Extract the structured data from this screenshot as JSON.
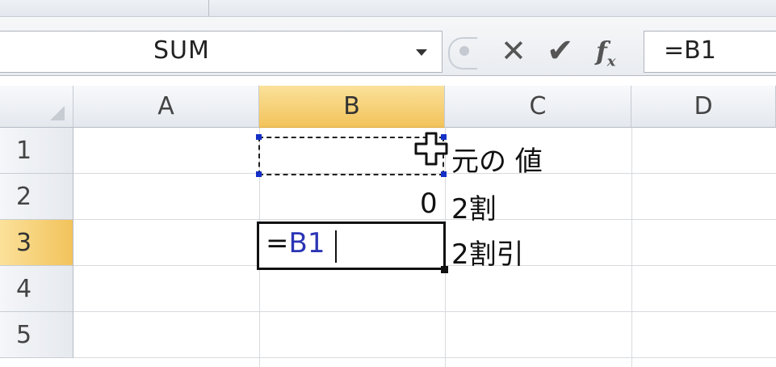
{
  "name_box": {
    "value": "SUM"
  },
  "formula_bar": {
    "cancel_icon": "cross-icon",
    "enter_icon": "check-icon",
    "fx_label": "f",
    "fx_sub": "x",
    "formula": "=B1"
  },
  "columns": [
    "A",
    "B",
    "C",
    "D"
  ],
  "selected_column": "B",
  "rows": [
    "1",
    "2",
    "3",
    "4",
    "5"
  ],
  "selected_row": "3",
  "cells": {
    "B2": "0",
    "C1": "元の 値",
    "C2": "2割",
    "C3": "2割引"
  },
  "editing_cell": {
    "address": "B3",
    "prefix": "=",
    "ref": "B1"
  },
  "colors": {
    "selected_header": "#f2c35b",
    "reference_blue": "#2b35b5"
  }
}
